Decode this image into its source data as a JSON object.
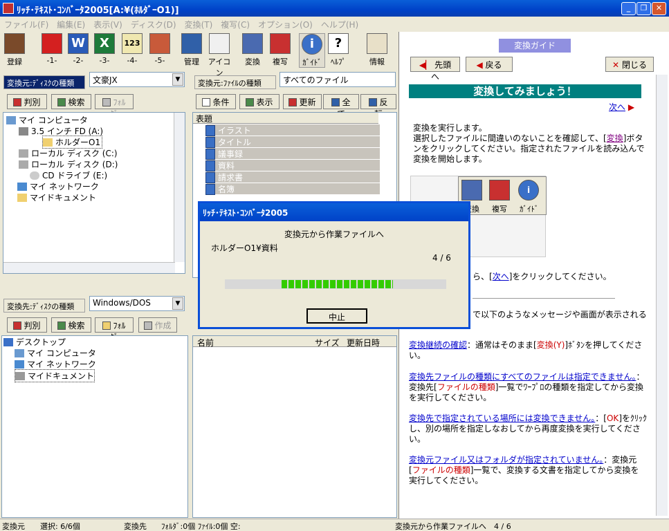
{
  "window": {
    "title": "ﾘｯﾁ･ﾃｷｽﾄ･ｺﾝﾊﾞｰﾀ2005[A:¥(ﾎﾙﾀﾞｰO1)]"
  },
  "menu": [
    "ファイル(F)",
    "編集(E)",
    "表示(V)",
    "ディスク(D)",
    "変換(T)",
    "複写(C)",
    "オプション(O)",
    "ヘルプ(H)"
  ],
  "toolbar": {
    "items": [
      {
        "label": "登録"
      },
      {
        "label": "-1-"
      },
      {
        "label": "-2-"
      },
      {
        "label": "-3-"
      },
      {
        "label": "-4-"
      },
      {
        "label": "-5-"
      },
      {
        "label": "管理"
      },
      {
        "label": "アイコン"
      },
      {
        "label": "変換"
      },
      {
        "label": "複写"
      },
      {
        "label": "ｶﾞｲﾄﾞ"
      },
      {
        "label": "ﾍﾙﾌﾟ"
      },
      {
        "label": "情報"
      }
    ],
    "icon_55": "123"
  },
  "source": {
    "disk_label": "変換元:ﾃﾞｨｽｸの種類",
    "disk_value": "文豪JX",
    "buttons": {
      "detect": "判別",
      "search": "検索",
      "folder": "ﾌｫﾙﾀﾞ"
    },
    "tree": [
      "マイ コンピュータ",
      "3.5 インチ FD (A:)",
      "ホルダーO1",
      "ローカル ディスク (C:)",
      "ローカル ディスク (D:)",
      "CD ドライブ (E:)",
      "マイ ネットワーク",
      "マイドキュメント"
    ]
  },
  "filelist": {
    "type_label": "変換元:ﾌｧｲﾙの種類",
    "type_value": "すべてのファイル",
    "buttons": {
      "cond": "条件",
      "show": "表示",
      "update": "更新",
      "all": "全て",
      "invert": "反転"
    },
    "column": "表題",
    "items": [
      "イラスト",
      "タイトル",
      "議事録",
      "資料",
      "請求書",
      "名簿"
    ]
  },
  "dest": {
    "disk_label": "変換先:ﾃﾞｨｽｸの種類",
    "disk_value": "Windows/DOS",
    "buttons": {
      "detect": "判別",
      "search": "検索",
      "folder": "ﾌｫﾙﾀﾞ",
      "create": "作成"
    },
    "tree": [
      "デスクトップ",
      "マイ コンピュータ",
      "マイ ネットワーク",
      "マイドキュメント"
    ],
    "columns": {
      "name": "名前",
      "size": "サイズ",
      "date": "更新日時"
    }
  },
  "guide": {
    "header": "変換ガイド",
    "buttons": {
      "top": "先頭へ",
      "back": "戻る",
      "close": "閉じる"
    },
    "heading": "変換してみましょう！",
    "next": "次へ",
    "para1a": "変換を実行します。",
    "para1b": "選択したファイルに間違いのないことを確認して、[",
    "para1link": "変換",
    "para1c": "]ボタンをクリックしてください。指定されたファイルを読み込んで変換を開始します。",
    "para2a": "ら、[",
    "para2link": "次へ",
    "para2b": "]をクリックしてください。",
    "para3": "で以下のようなメッセージや画面が表示される",
    "img_labels": {
      "conv": "変換",
      "copy": "複写",
      "guide": "ｶﾞｲﾄﾞ"
    },
    "items": [
      {
        "link": "変換継続の確認",
        "pre": "：通常はそのまま[",
        "red": "変換(Y)",
        "post": "]ﾎﾞﾀﾝを押してください。"
      },
      {
        "link": "変換先ファイルの種類にすべてのファイルは指定できません。",
        "pre": "：変換先[",
        "red": "ファイルの種類",
        "post": "]一覧でﾜｰﾌﾟﾛの種類を指定してから変換を実行してください。"
      },
      {
        "link": "変換先で指定されている場所には変換できません。",
        "pre": "：[",
        "red": "OK",
        "post": "]をｸﾘｯｸし、別の場所を指定しなおしてから再度変換を実行してください。"
      },
      {
        "link": "変換元ファイル又はフォルダが指定されていません。",
        "pre": "：変換元[",
        "red": "ファイルの種類",
        "post": "]一覧で、変換する文書を指定してから変換を実行してください。"
      }
    ]
  },
  "dialog": {
    "title": "ﾘｯﾁ･ﾃｷｽﾄ･ｺﾝﾊﾞｰﾀ2005",
    "message": "変換元から作業ファイルへ",
    "path": "ホルダーO1¥資料",
    "count": "4 / 6",
    "progress": 0.67,
    "cancel": "中止"
  },
  "status": {
    "src": "変換元",
    "selected": "選択: 6/6個",
    "dst": "変換先",
    "dst_info": "ﾌｫﾙﾀﾞ:0個 ﾌｧｲﾙ:0個 空:",
    "progress": "変換元から作業ファイルへ　4 / 6"
  },
  "colors": {
    "title_bar": "#0042c8",
    "progress": "#33cc00",
    "heading_bg": "#008080"
  }
}
